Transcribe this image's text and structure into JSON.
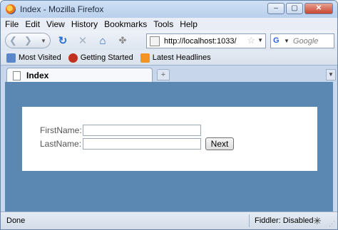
{
  "window": {
    "title": "Index - Mozilla Firefox",
    "controls": {
      "minimize": "–",
      "maximize": "▢",
      "close": "✕"
    }
  },
  "menu": {
    "file": "File",
    "edit": "Edit",
    "view": "View",
    "history": "History",
    "bookmarks": "Bookmarks",
    "tools": "Tools",
    "help": "Help"
  },
  "toolbar": {
    "url": "http://localhost:1033/",
    "search_placeholder": "Google",
    "icons": [
      "back-icon",
      "forward-icon",
      "reload-icon",
      "stop-icon",
      "home-icon",
      "addon-icon",
      "star-icon"
    ]
  },
  "bookmarks": [
    {
      "label": "Most Visited",
      "icon": "most-visited-icon"
    },
    {
      "label": "Getting Started",
      "icon": "getting-started-icon"
    },
    {
      "label": "Latest Headlines",
      "icon": "rss-icon"
    }
  ],
  "tabs": [
    {
      "label": "Index"
    }
  ],
  "form": {
    "first_name_label": "FirstName:",
    "first_name_value": "",
    "last_name_label": "LastName:",
    "last_name_value": "",
    "next_label": "Next"
  },
  "status": {
    "text": "Done",
    "fiddler": "Fiddler: Disabled"
  },
  "colors": {
    "content_background": "#5b87b3",
    "panel_background": "#ffffff"
  }
}
